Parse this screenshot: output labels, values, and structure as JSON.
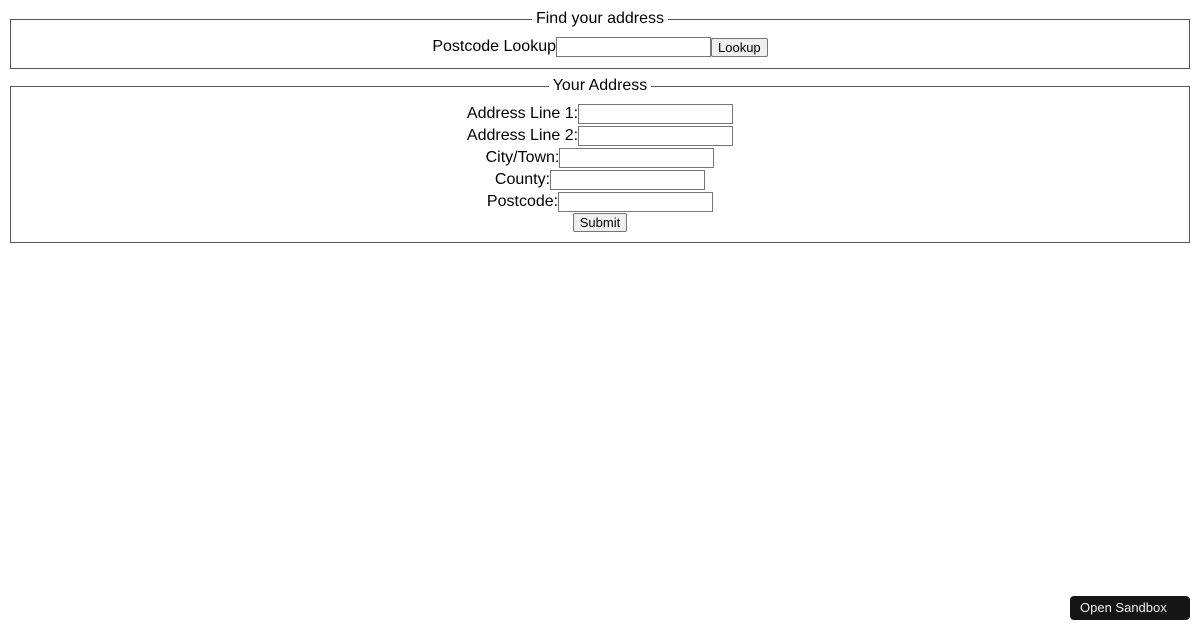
{
  "lookup": {
    "legend": "Find your address",
    "label": "Postcode Lookup",
    "input_value": "",
    "button_label": "Lookup"
  },
  "address": {
    "legend": "Your Address",
    "fields": {
      "line1_label": "Address Line 1:",
      "line1_value": "",
      "line2_label": "Address Line 2:",
      "line2_value": "",
      "city_label": "City/Town:",
      "city_value": "",
      "county_label": "County:",
      "county_value": "",
      "postcode_label": "Postcode:",
      "postcode_value": ""
    },
    "submit_label": "Submit"
  },
  "sandbox_button": "Open Sandbox"
}
